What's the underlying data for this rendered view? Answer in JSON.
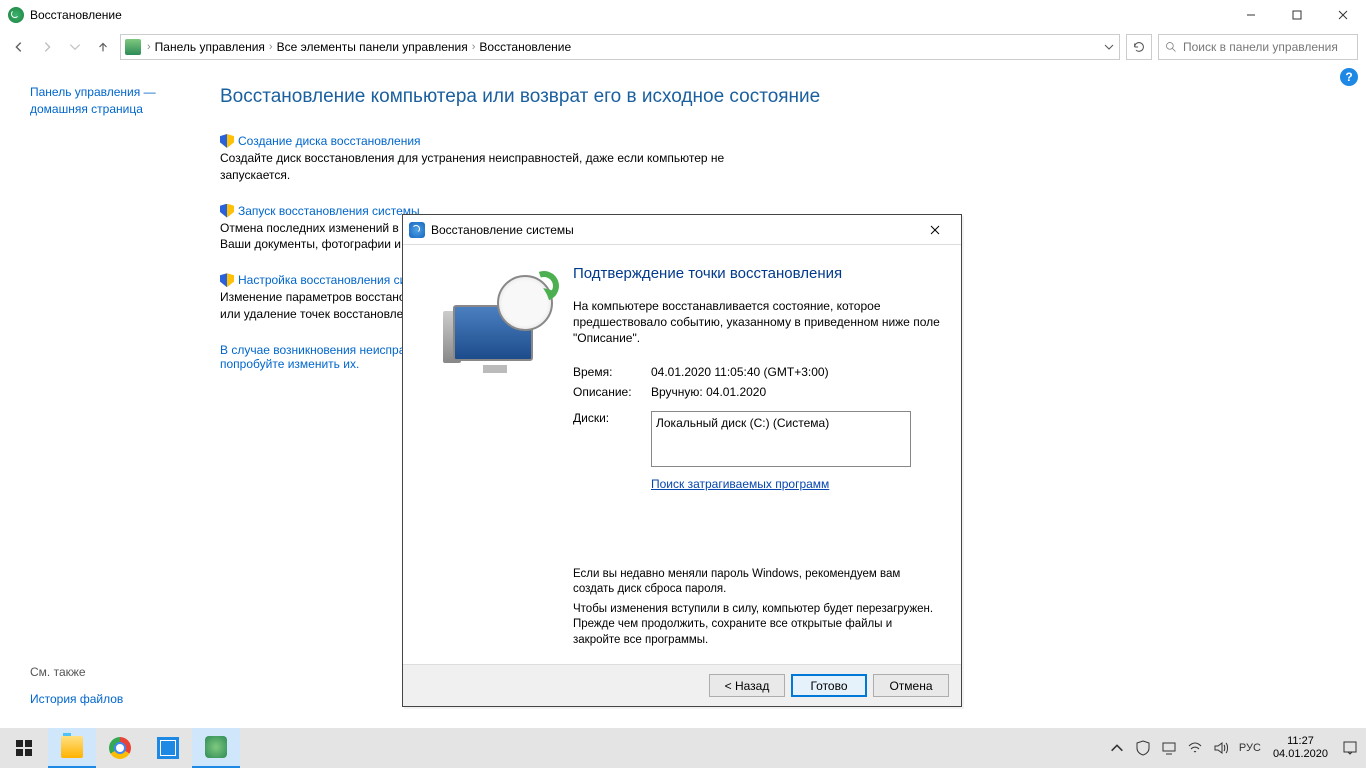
{
  "window": {
    "title": "Восстановление"
  },
  "breadcrumb": {
    "root": "Панель управления",
    "mid": "Все элементы панели управления",
    "leaf": "Восстановление"
  },
  "search": {
    "placeholder": "Поиск в панели управления"
  },
  "sidebar": {
    "home1": "Панель управления —",
    "home2": "домашняя страница",
    "see_also": "См. также",
    "history": "История файлов"
  },
  "main": {
    "heading": "Восстановление компьютера или возврат его в исходное состояние",
    "items": [
      {
        "link": "Создание диска восстановления",
        "desc": "Создайте диск восстановления для устранения неисправностей, даже если компьютер не запускается."
      },
      {
        "link": "Запуск восстановления системы",
        "desc": "Отмена последних изменений в системе, таких как установка программы или драйвера. Ваши документы, фотографии и музыка, остаются без изменений."
      },
      {
        "link": "Настройка восстановления системы",
        "desc": "Изменение параметров восстановления, управление дисковым пространством и создание или удаление точек восстановления."
      }
    ],
    "footer_link": "В случае возникновения неисправностей с компьютером перейдите к его параметрам и попробуйте изменить их."
  },
  "dialog": {
    "title": "Восстановление системы",
    "heading": "Подтверждение точки восстановления",
    "intro": "На компьютере восстанавливается состояние, которое предшествовало событию, указанному в приведенном ниже поле \"Описание\".",
    "time_lbl": "Время:",
    "time_val": "04.01.2020 11:05:40 (GMT+3:00)",
    "desc_lbl": "Описание:",
    "desc_val": "Вручную: 04.01.2020",
    "disks_lbl": "Диски:",
    "disks_val": "Локальный диск (C:) (Система)",
    "search_link": "Поиск затрагиваемых программ",
    "warn1": "Если вы недавно меняли пароль Windows, рекомендуем вам создать диск сброса пароля.",
    "warn2": "Чтобы изменения вступили в силу, компьютер будет перезагружен. Прежде чем продолжить, сохраните все открытые файлы и закройте все программы.",
    "btn_back": "< Назад",
    "btn_finish": "Готово",
    "btn_cancel": "Отмена"
  },
  "tray": {
    "lang": "РУС",
    "time": "11:27",
    "date": "04.01.2020"
  }
}
